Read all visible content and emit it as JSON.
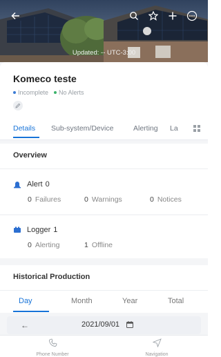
{
  "header": {
    "updated_text": "Updated: -- UTC-3:00"
  },
  "site": {
    "title": "Komeco teste",
    "status_incomplete": "Incomplete",
    "status_alerts": "No Alerts"
  },
  "tabs": [
    {
      "label": "Details"
    },
    {
      "label": "Sub-system/Device"
    },
    {
      "label": "Alerting"
    },
    {
      "label": "La"
    }
  ],
  "overview": {
    "title": "Overview",
    "alert": {
      "label": "Alert",
      "count": "0",
      "failures_num": "0",
      "failures_label": "Failures",
      "warnings_num": "0",
      "warnings_label": "Warnings",
      "notices_num": "0",
      "notices_label": "Notices"
    },
    "logger": {
      "label": "Logger",
      "count": "1",
      "alerting_num": "0",
      "alerting_label": "Alerting",
      "offline_num": "1",
      "offline_label": "Offline"
    }
  },
  "historical": {
    "title": "Historical Production",
    "periods": [
      "Day",
      "Month",
      "Year",
      "Total"
    ],
    "date": "2021/09/01",
    "back_arrow": "←"
  },
  "bottom_nav": {
    "phone_label": "Phone Number",
    "navigation_label": "Navigation"
  },
  "colors": {
    "accent": "#1773d8",
    "incomplete_dot": "#3a7bd5",
    "no_alerts_dot": "#3bb36b",
    "alert_icon": "#2c6fd1",
    "logger_icon": "#2c6fd1"
  }
}
